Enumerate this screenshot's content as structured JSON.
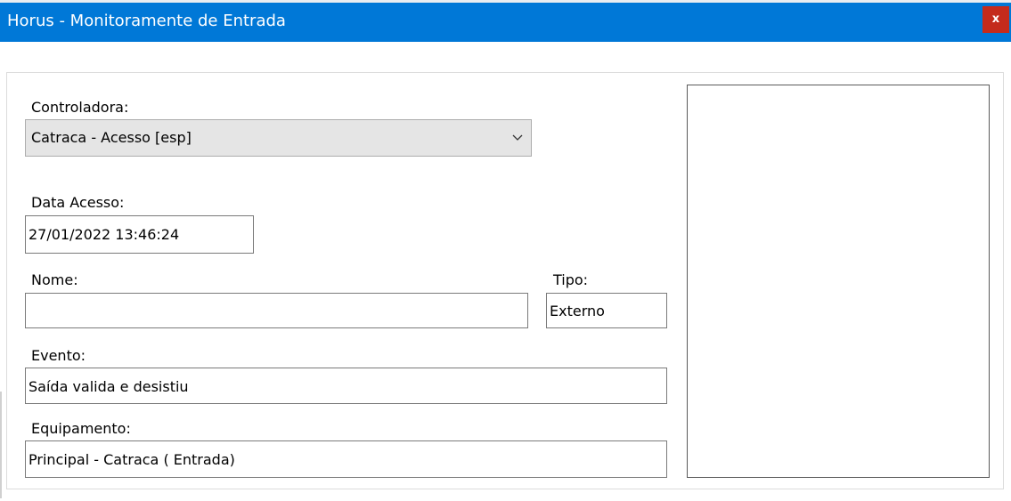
{
  "window": {
    "title": "Horus - Monitoramente de Entrada",
    "close_label": "x"
  },
  "form": {
    "controladora": {
      "label": "Controladora:",
      "selected": "Catraca - Acesso [esp]"
    },
    "data_acesso": {
      "label": "Data Acesso:",
      "value": "27/01/2022 13:46:24"
    },
    "nome": {
      "label": "Nome:",
      "value": ""
    },
    "tipo": {
      "label": "Tipo:",
      "value": "Externo"
    },
    "evento": {
      "label": "Evento:",
      "value": "Saída valida e desistiu"
    },
    "equipamento": {
      "label": "Equipamento:",
      "value": "Principal - Catraca ( Entrada)"
    }
  },
  "icons": {
    "dropdown": "chevron-down-icon",
    "close": "close-icon"
  },
  "colors": {
    "titlebar": "#0078d7",
    "close_button": "#c42b1c",
    "combo_background": "#e5e5e5"
  }
}
